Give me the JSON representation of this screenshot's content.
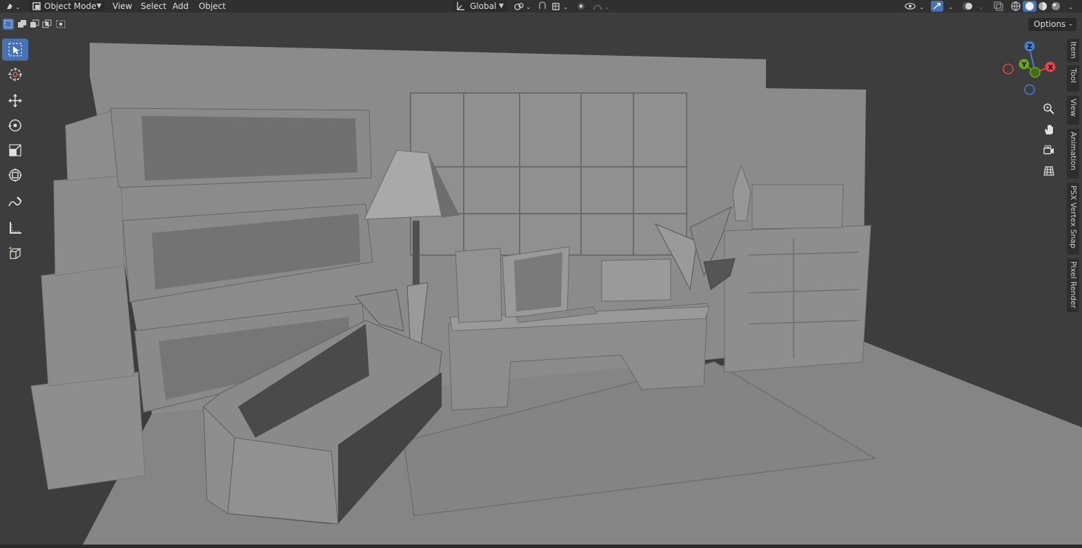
{
  "header": {
    "editor_type_icon": "object-mode-cube-icon",
    "mode_label": "Object Mode",
    "menus": [
      "View",
      "Select",
      "Add",
      "Object"
    ],
    "transform_orientation": "Global",
    "icons": [
      "pivot-icon",
      "snap-icon",
      "proportional-icon",
      "visibility-icon",
      "gizmo-icon",
      "overlay-icon",
      "xray-icon",
      "shading-wireframe-icon",
      "shading-solid-icon",
      "shading-material-icon",
      "shading-rendered-icon"
    ]
  },
  "toolbar": {
    "options_label": "Options",
    "tools": [
      "select-box-icon",
      "cursor-icon",
      "move-icon",
      "rotate-icon",
      "scale-icon",
      "transform-icon",
      "annotate-icon",
      "measure-icon",
      "add-cube-icon"
    ]
  },
  "gizmo": {
    "x_label": "X",
    "y_label": "Y",
    "z_label": "Z",
    "x_color": "#e8424a",
    "y_color": "#6aa41e",
    "z_color": "#3f80d6"
  },
  "nav_buttons": [
    "zoom-icon",
    "hand-pan-icon",
    "camera-icon",
    "grid-ortho-icon"
  ],
  "sidebar_tabs": [
    "Item",
    "Tool",
    "View",
    "Animation",
    "PSX Vertex Snap",
    "Pixel Render"
  ],
  "colors": {
    "accent": "#4772b3",
    "header_bg": "#303030",
    "viewport_bg": "#3d3d3d"
  }
}
